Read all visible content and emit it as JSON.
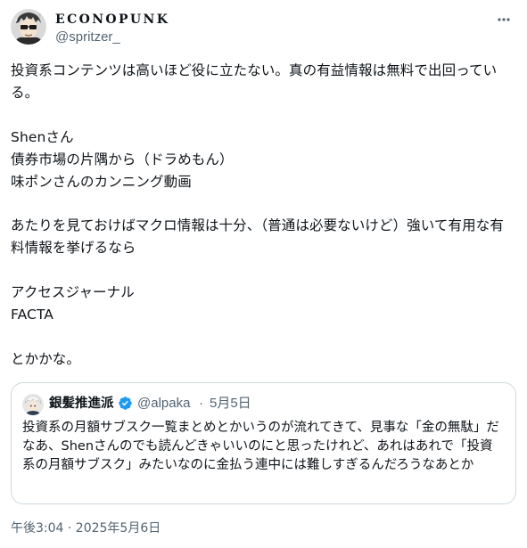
{
  "author": {
    "display_name": "ECONOPUNK",
    "handle": "@spritzer_"
  },
  "post": {
    "text": "投資系コンテンツは高いほど役に立たない。真の有益情報は無料で出回っている。\n\nShenさん\n債券市場の片隅から（ドラめもん）\n味ポンさんのカンニング動画\n\nあたりを見ておけばマクロ情報は十分、（普通は必要ないけど）強いて有用な有料情報を挙げるなら\n\nアクセスジャーナル\nFACTA\n\nとかかな。",
    "timestamp": "午後3:04 · 2025年5月6日"
  },
  "quote": {
    "display_name": "銀髪推進派",
    "handle": "@alpaka",
    "separator": "·",
    "date": "5月5日",
    "text": "投資系の月額サブスク一覧まとめとかいうのが流れてきて、見事な「金の無駄」だなあ、Shenさんのでも読んどきゃいいのにと思ったけれど、あれはあれで「投資系の月額サブスク」みたいなのに金払う連中には難しすぎるんだろうなあとか"
  },
  "icons": {
    "more": "more-horizontal-icon",
    "verified": "verified-badge-icon"
  },
  "colors": {
    "text_primary": "#0f1419",
    "text_secondary": "#536471",
    "border": "#cfd9de",
    "verified_blue": "#1d9bf0"
  }
}
